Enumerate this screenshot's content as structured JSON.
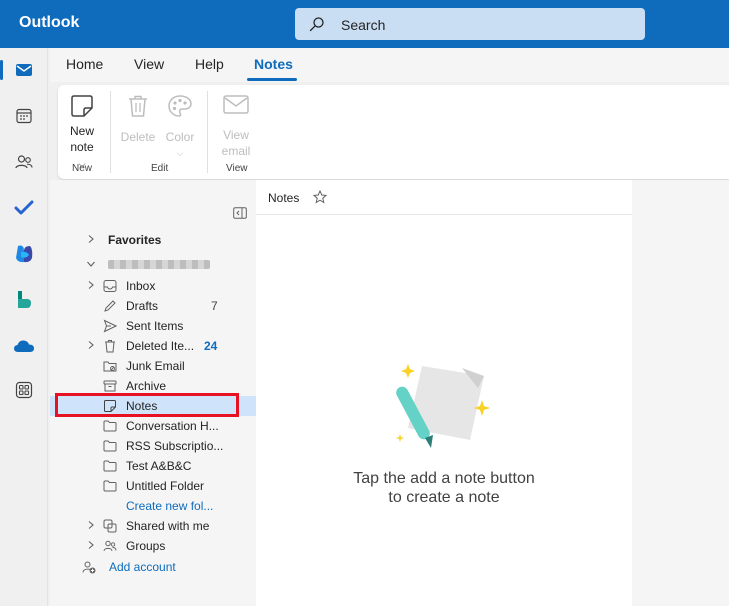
{
  "app": {
    "title": "Outlook",
    "search_placeholder": "Search",
    "accent_color": "#0f6cbd"
  },
  "rail": {
    "items": [
      "mail-icon",
      "calendar-icon",
      "people-icon",
      "todo-icon",
      "office-icon",
      "bookings-icon",
      "onedrive-icon",
      "more-apps-icon"
    ]
  },
  "menu": {
    "tabs": [
      "Home",
      "View",
      "Help",
      "Notes"
    ],
    "active": "Notes"
  },
  "ribbon": {
    "new_note": {
      "line1": "New",
      "line2": "note"
    },
    "delete": "Delete",
    "color": "Color",
    "view_email": {
      "line1": "View",
      "line2": "email"
    },
    "groups": {
      "new": "New",
      "edit": "Edit",
      "view": "View"
    }
  },
  "folders": {
    "favorites": "Favorites",
    "items": [
      {
        "name": "Inbox"
      },
      {
        "name": "Drafts",
        "count": "7"
      },
      {
        "name": "Sent Items"
      },
      {
        "name": "Deleted Ite...",
        "count": "24"
      },
      {
        "name": "Junk Email"
      },
      {
        "name": "Archive"
      },
      {
        "name": "Notes"
      },
      {
        "name": "Conversation H..."
      },
      {
        "name": "RSS Subscriptio..."
      },
      {
        "name": "Test A&B&C"
      },
      {
        "name": "Untitled Folder"
      }
    ],
    "create_new": "Create new fol...",
    "shared_with_me": "Shared with me",
    "groups": "Groups",
    "add_account": "Add account"
  },
  "notes": {
    "header": "Notes",
    "empty_line1": "Tap the add a note button",
    "empty_line2": "to create a note"
  }
}
